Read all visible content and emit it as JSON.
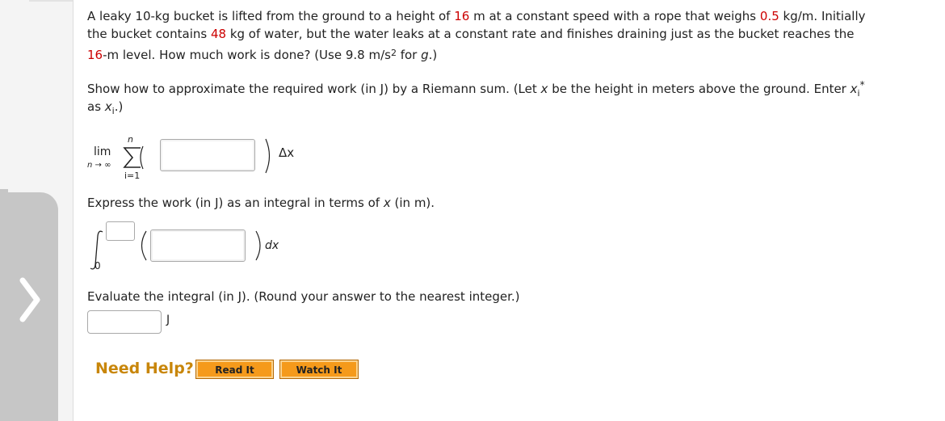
{
  "problem": {
    "text_a": "A leaky 10-kg bucket is lifted from the ground to a height of ",
    "height_1": "16",
    "text_b": " m at a constant speed with a rope that weighs ",
    "rope_weight": "0.5",
    "text_c": " kg/m. Initially",
    "text_d": "the bucket contains ",
    "water_mass": "48",
    "text_e": " kg of water, but the water leaks at a constant rate and finishes draining just as the bucket reaches the",
    "height_2": "16",
    "text_f": "-m level. How much work is done? (Use 9.8 m/s",
    "exp_2": "2",
    "text_g": " for ",
    "g_var": "g",
    "text_h": ".)"
  },
  "part1": {
    "prompt_a": "Show how to approximate the required work (in J) by a Riemann sum. (Let ",
    "x_var": "x",
    "prompt_b": " be the height in meters above the ground. Enter ",
    "xi_var": "x",
    "xi_sub": "i",
    "xi_star": "*",
    "prompt_c": "as ",
    "xi_var2": "x",
    "xi_sub2": "i",
    "prompt_d": ".)",
    "lim": "lim",
    "lim_sub": "n → ∞",
    "sum_upper": "n",
    "sum_lower": "i=1",
    "delta_x": "Δx"
  },
  "part2": {
    "prompt_a": "Express the work (in J) as an integral in terms of ",
    "x_var": "x",
    "prompt_b": " (in m).",
    "lower_limit": "0",
    "dx": "dx"
  },
  "part3": {
    "prompt": "Evaluate the integral (in J). (Round your answer to the nearest integer.)",
    "unit": "J"
  },
  "help": {
    "label": "Need Help?",
    "read_it": "Read It",
    "watch_it": "Watch It"
  },
  "colors": {
    "highlight": "#cc0000",
    "need_help": "#c8860a",
    "button": "#f59a1b"
  },
  "icons": {
    "nav": "chevron-right-icon"
  }
}
